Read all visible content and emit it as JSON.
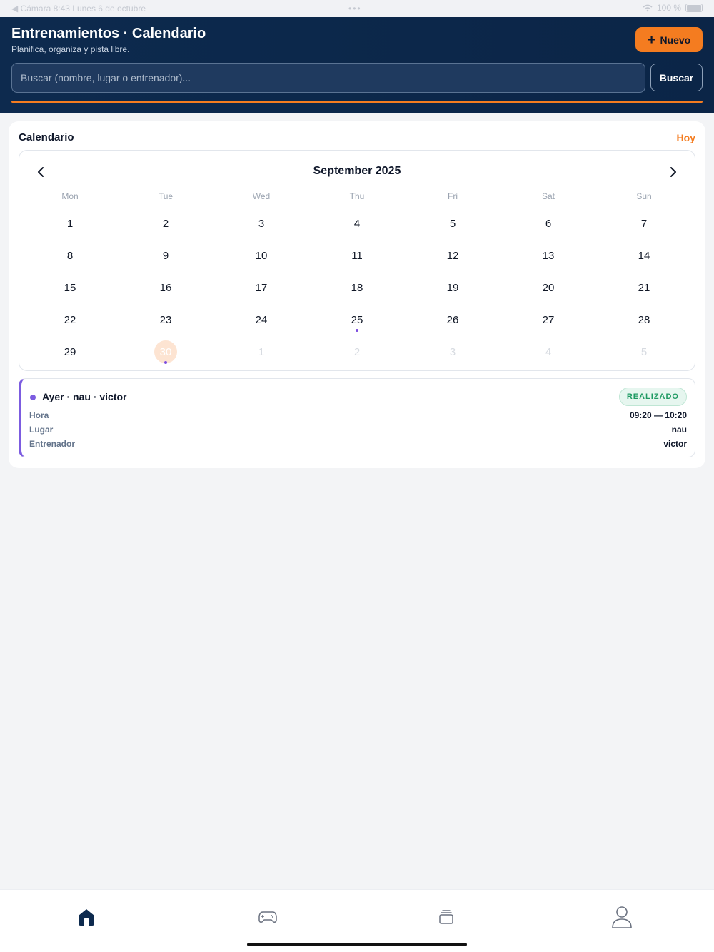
{
  "status_bar": {
    "left_text": "◀ Cámara   8:43   Lunes 6 de octubre",
    "center_dots": "•••",
    "battery_text": "100 %"
  },
  "header": {
    "title": "Entrenamientos · Calendario",
    "subtitle": "Planifica, organiza y pista libre.",
    "new_button_label": "Nuevo",
    "search_placeholder": "Buscar (nombre, lugar o entrenador)...",
    "search_button_label": "Buscar"
  },
  "calendar_card": {
    "title": "Calendario",
    "today_label": "Hoy",
    "month_label": "September 2025",
    "weekdays": [
      "Mon",
      "Tue",
      "Wed",
      "Thu",
      "Fri",
      "Sat",
      "Sun"
    ],
    "weeks": [
      [
        {
          "d": "1"
        },
        {
          "d": "2"
        },
        {
          "d": "3"
        },
        {
          "d": "4"
        },
        {
          "d": "5"
        },
        {
          "d": "6"
        },
        {
          "d": "7"
        }
      ],
      [
        {
          "d": "8"
        },
        {
          "d": "9"
        },
        {
          "d": "10"
        },
        {
          "d": "11"
        },
        {
          "d": "12"
        },
        {
          "d": "13"
        },
        {
          "d": "14"
        }
      ],
      [
        {
          "d": "15"
        },
        {
          "d": "16"
        },
        {
          "d": "17"
        },
        {
          "d": "18"
        },
        {
          "d": "19"
        },
        {
          "d": "20"
        },
        {
          "d": "21"
        }
      ],
      [
        {
          "d": "22"
        },
        {
          "d": "23"
        },
        {
          "d": "24"
        },
        {
          "d": "25",
          "dot": true
        },
        {
          "d": "26"
        },
        {
          "d": "27"
        },
        {
          "d": "28"
        }
      ],
      [
        {
          "d": "29"
        },
        {
          "d": "30",
          "today": true,
          "dot": true
        },
        {
          "d": "1",
          "other": true
        },
        {
          "d": "2",
          "other": true
        },
        {
          "d": "3",
          "other": true
        },
        {
          "d": "4",
          "other": true
        },
        {
          "d": "5",
          "other": true
        }
      ]
    ]
  },
  "event": {
    "title": "Ayer · nau · victor",
    "status": "REALIZADO",
    "rows": [
      {
        "label": "Hora",
        "value": "09:20 — 10:20"
      },
      {
        "label": "Lugar",
        "value": "nau"
      },
      {
        "label": "Entrenador",
        "value": "victor"
      }
    ]
  },
  "colors": {
    "header_bg": "#0d2a4e",
    "accent": "#f47c20",
    "event_accent": "#7c5ce0",
    "status_green": "#1f9a63"
  },
  "bottom_nav": {
    "tabs": [
      "home-icon",
      "gamepad-icon",
      "stack-icon",
      "user-icon"
    ],
    "active": "home-icon"
  }
}
